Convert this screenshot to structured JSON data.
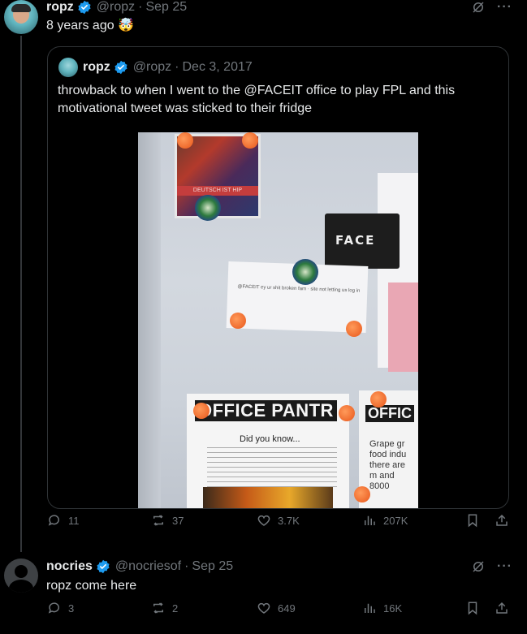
{
  "main_tweet": {
    "name": "ropz",
    "handle": "@ropz",
    "date": "Sep 25",
    "text": "8 years ago 🤯",
    "stats": {
      "replies": "11",
      "reposts": "37",
      "likes": "3.7K",
      "views": "207K"
    }
  },
  "quoted_tweet": {
    "name": "ropz",
    "handle": "@ropz",
    "date": "Dec 3, 2017",
    "text_line1": "throwback to when I went to the @FACEIT office to play FPL and this",
    "text_line2": "motivational tweet was sticked to their fridge",
    "photo": {
      "poster_text": "DEUTSCH IST HIP",
      "sign_text": "FACE",
      "printed_tweet": "@FACEIT ey ur shit broken fam · site not letting us log in",
      "pantry_title": "OFFICE PANTR",
      "pantry_sub": "Did you know...",
      "office2_title": "OFFIC",
      "office2_text": "Grape gr food indu there are m and 8000"
    }
  },
  "reply": {
    "name": "nocries",
    "handle": "@nocriesof",
    "date": "Sep 25",
    "text": "ropz come here",
    "stats": {
      "replies": "3",
      "reposts": "2",
      "likes": "649",
      "views": "16K"
    }
  },
  "icons": {
    "more": "···"
  },
  "colors": {
    "verified": "#1d9bf0",
    "muted": "#71767b",
    "text": "#e7e9ea",
    "border": "#2f3336"
  }
}
